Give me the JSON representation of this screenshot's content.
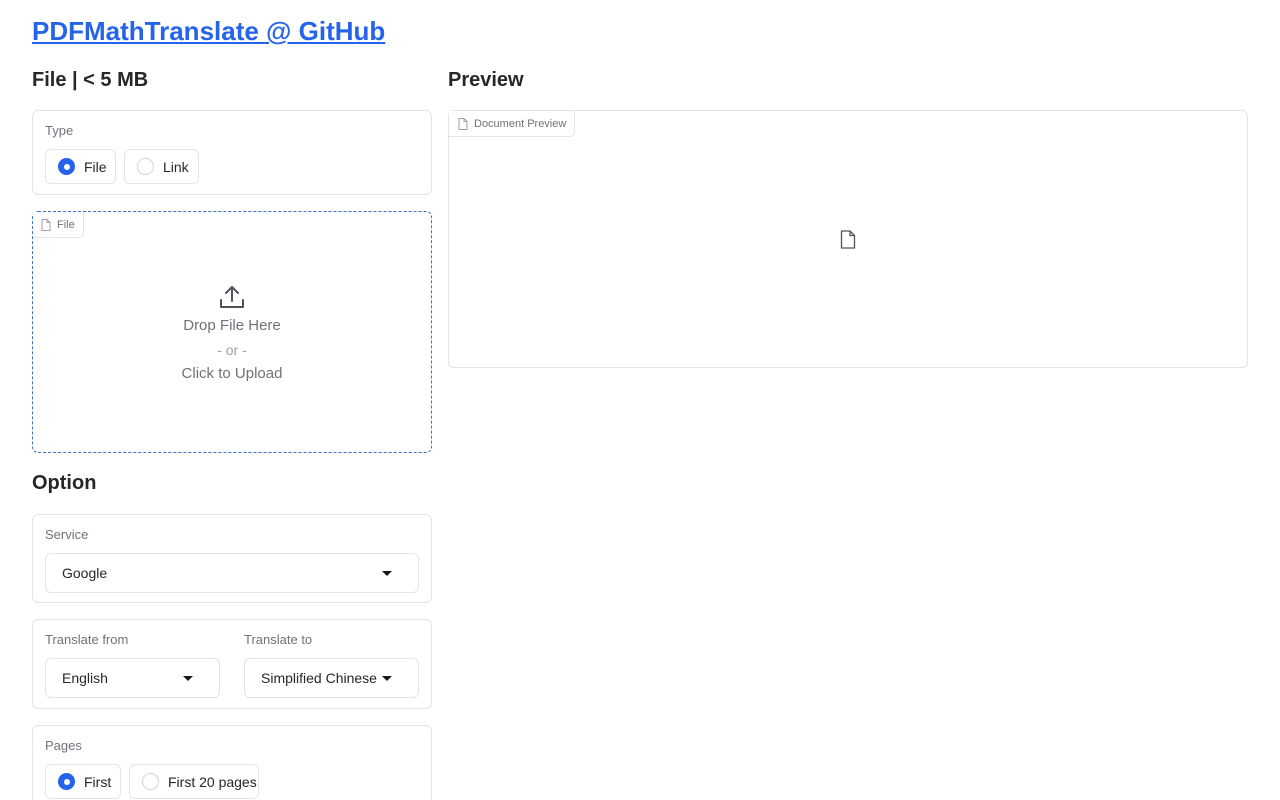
{
  "header": {
    "title_link": "PDFMathTranslate @ GitHub"
  },
  "file_section": {
    "heading": "File | < 5 MB",
    "type_label": "Type",
    "type_options": [
      {
        "label": "File",
        "selected": true
      },
      {
        "label": "Link",
        "selected": false
      }
    ],
    "upload": {
      "corner_label": "File",
      "drop_text": "Drop File Here",
      "or_text": "- or -",
      "click_text": "Click to Upload"
    }
  },
  "preview_section": {
    "heading": "Preview",
    "corner_label": "Document Preview"
  },
  "option_section": {
    "heading": "Option",
    "service": {
      "label": "Service",
      "value": "Google"
    },
    "translate_from": {
      "label": "Translate from",
      "value": "English"
    },
    "translate_to": {
      "label": "Translate to",
      "value": "Simplified Chinese"
    },
    "pages": {
      "label": "Pages",
      "options": [
        {
          "label": "First",
          "selected": true
        },
        {
          "label": "First 20 pages",
          "selected": false
        }
      ]
    }
  },
  "icons": {
    "upload": "upload-icon",
    "file": "file-icon"
  },
  "colors": {
    "accent": "#2563eb",
    "border": "#e4e4e7",
    "muted_text": "#71717a"
  }
}
